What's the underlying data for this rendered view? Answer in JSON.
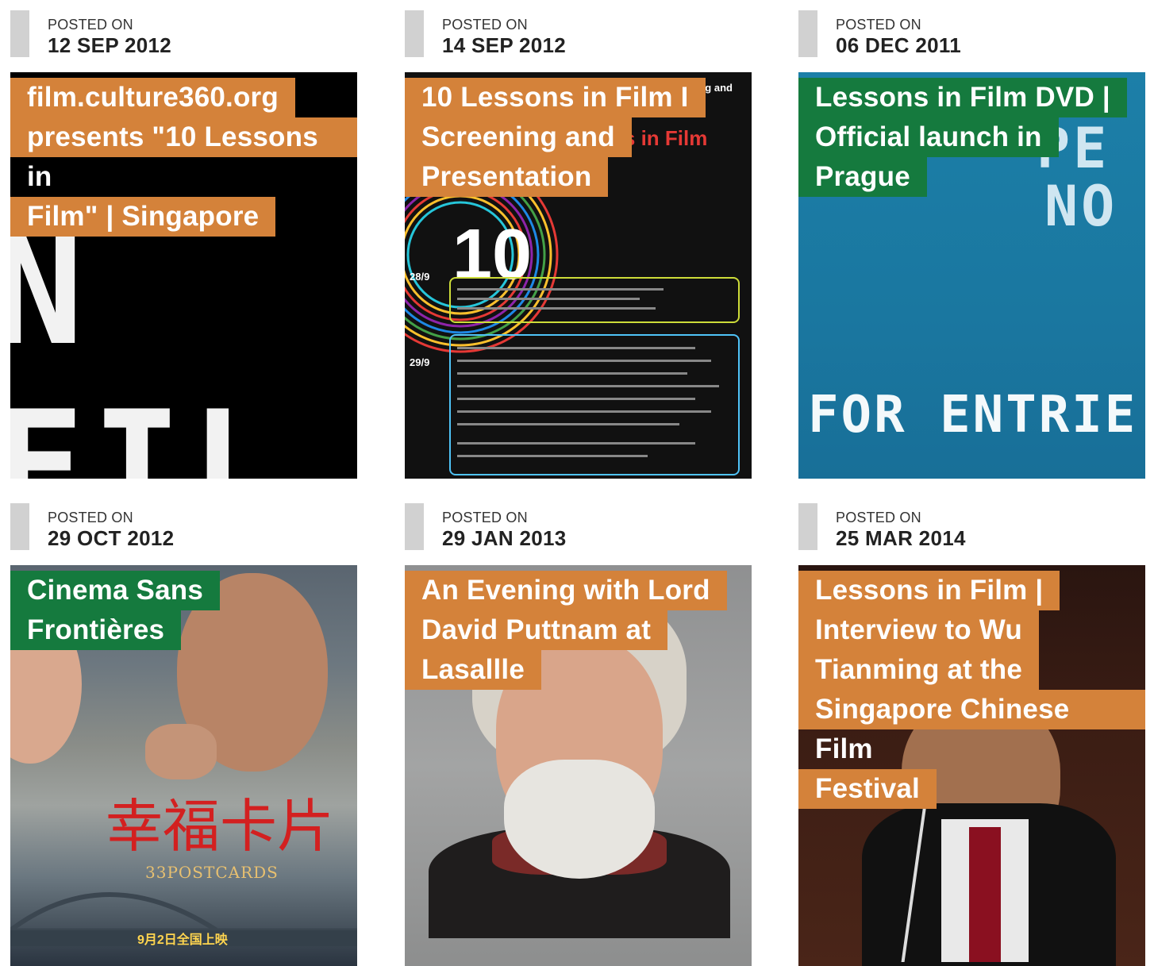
{
  "posted_label": "POSTED ON",
  "posts": [
    {
      "date": "12 SEP 2012",
      "title_lines": [
        "film.culture360.org",
        "presents \"10 Lessons in",
        "Film\" | Singapore"
      ],
      "tag_color": "orange",
      "image": {
        "text": "N FIL"
      }
    },
    {
      "date": "14 SEP 2012",
      "title_lines": [
        "10 Lessons in Film I",
        "Screening and",
        "Presentation"
      ],
      "tag_color": "orange",
      "image": {
        "top_text": "360.org and",
        "heading": "ns in Film",
        "big_number": "10",
        "day1": "28/9",
        "day2": "29/9"
      }
    },
    {
      "date": "06 DEC 2011",
      "title_lines": [
        "Lessons in Film DVD |",
        "Official launch in",
        "Prague"
      ],
      "tag_color": "green",
      "image": {
        "line1": "PE",
        "line2": "NO",
        "line3": "FOR ENTRIE"
      }
    },
    {
      "date": "29 OCT 2012",
      "title_lines": [
        "Cinema Sans",
        "Frontières"
      ],
      "tag_color": "green",
      "image": {
        "calligraphy": "幸福卡片",
        "subtitle": "33POSTCARDS",
        "release": "9月2日全国上映"
      }
    },
    {
      "date": "29 JAN 2013",
      "title_lines": [
        "An Evening with Lord",
        "David Puttnam at",
        "Lasallle"
      ],
      "tag_color": "orange",
      "image": {}
    },
    {
      "date": "25 MAR 2014",
      "title_lines": [
        "Lessons in Film |",
        "Interview to Wu",
        "Tianming at the",
        "Singapore Chinese Film",
        "Festival"
      ],
      "tag_color": "orange",
      "image": {}
    }
  ]
}
